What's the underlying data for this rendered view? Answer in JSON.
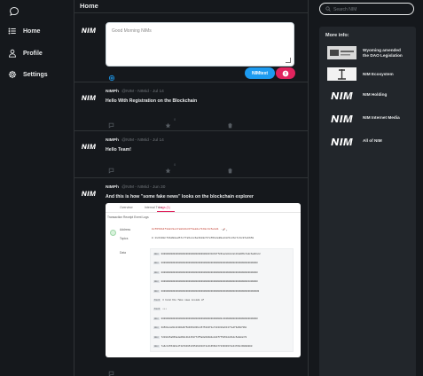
{
  "nav": {
    "items": [
      {
        "label": "Home",
        "icon": "list-icon"
      },
      {
        "label": "Profile",
        "icon": "user-icon"
      },
      {
        "label": "Settings",
        "icon": "gear-icon"
      }
    ]
  },
  "main": {
    "title": "Home",
    "composer": {
      "placeholder": "Good Morning NIMs",
      "post_label": "NIMtext"
    }
  },
  "tweets": [
    {
      "name": "NIMPh",
      "meta": "@NIM - NIMid - Jul 14",
      "text": "Hello With Registration on the Blockchain"
    },
    {
      "name": "NIMPh",
      "meta": "@NIM - NIMid - Jul 14",
      "text": "Hello Team!"
    },
    {
      "name": "NIMPh",
      "meta": "@NIM - NIMid - Jun 30",
      "text": "And this is how \"some fake news\" looks on the blockchain explorer",
      "embed": {
        "tabs": [
          "Overview",
          "Internal Txns",
          "Logs (1)"
        ],
        "subtitle": "Transaction Receipt Event Logs",
        "address_label": "Address",
        "address": "0x5559b4f3d2c9e17a8b04c6f3a2de71b9c3c5e8d1 · 4",
        "chip": "⊕ ⌄",
        "topics_label": "Topics",
        "topics": "0 0x6190c7b6d98ad57c77a5e1c6a3b02c57e55b2a99e04c5c26c7c9c97a6b58",
        "data_label": "Data",
        "data_lines": [
          {
            "tag": "Hex",
            "val": "00000000000000000000000000000000002310b37f831a2e04c2a116dd95e7a0c6a8b1c2"
          },
          {
            "tag": "Hex",
            "val": "0000000000000000000000000000000000000000000000000000000000000000000000"
          },
          {
            "tag": "Hex",
            "val": "0000000000000000000000000000000000000000000000000000000000000000000000"
          },
          {
            "tag": "Hex",
            "val": "0000000000000000000000000000000000000000000000000000000000000001000000"
          },
          {
            "tag": "Hex",
            "val": "00000000000000000000000000000000000000000000000000000000000000000000000"
          },
          {
            "tag": "Text",
            "val": "I hold the fake news inside of"
          },
          {
            "tag": "Text",
            "val": "•••"
          },
          {
            "tag": "Hex",
            "val": "00000000000000000000000000000000000000000000c0000000000000000000000000"
          },
          {
            "tag": "Hex",
            "val": "68564e4e6b41396d67583952366c4575334f4e7143316a51377a4f6d69736b"
          },
          {
            "tag": "Hex",
            "val": "7219415a656a4a666c4b4154774f5a6a58384e444f7752544c6b4c5a6d4c70"
          },
          {
            "tag": "Hex",
            "val": "7a6c4155486e4f4870495133526231674e31656b47723939374e64796c36000000"
          }
        ]
      }
    }
  ],
  "search": {
    "placeholder": "Search NIM"
  },
  "news": {
    "title": "More info:",
    "items": [
      {
        "text_1": "Wyoming amended",
        "text_2": "the DAO Legislation",
        "thumb": "wyoming-thumb"
      },
      {
        "text_1": "NIM Ecosystem",
        "text_2": "",
        "thumb": "ecosystem-thumb"
      },
      {
        "text_1": "NIM Holding",
        "text_2": "",
        "thumb": "nim-logo"
      },
      {
        "text_1": "NIM Internet Media",
        "text_2": "",
        "thumb": "nim-logo"
      },
      {
        "text_1": "All of NIM",
        "text_2": "",
        "thumb": "nim-logo"
      }
    ]
  },
  "colors": {
    "accent": "#1d9bf0",
    "danger": "#e0245e",
    "background": "#15181c",
    "panel": "#22262b"
  }
}
